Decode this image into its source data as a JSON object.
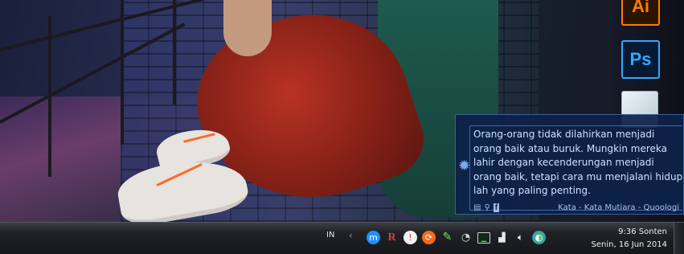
{
  "desktop": {
    "dock_icons": [
      {
        "label": "Ai",
        "icon": "illustrator-icon"
      },
      {
        "label": "Ps",
        "icon": "photoshop-icon"
      },
      {
        "label": "",
        "icon": "app-cube-icon"
      }
    ]
  },
  "notification": {
    "quote": "Orang-orang tidak dilahirkan menjadi orang baik atau buruk. Mungkin mereka lahir dengan kecenderungan menjadi orang baik, tetapi cara mu menjalani hidup lah yang paling penting.",
    "source": "Kata - Kata Mutiara - Quoologi",
    "icons": [
      "document-icon",
      "search-icon",
      "facebook-icon"
    ]
  },
  "taskbar": {
    "language": "IN",
    "overflow_chevron": "‹",
    "tray_icons": [
      "app-m-icon",
      "app-r-icon",
      "chat-icon",
      "update-icon",
      "pencil-icon",
      "sync-icon",
      "monitor-icon",
      "network-icon",
      "volume-icon",
      "globe-icon"
    ],
    "clock": {
      "time": "9:36 Sonten",
      "date": "Senin, 16 Jun 2014"
    }
  },
  "colors": {
    "notification_bg": "#0d2149",
    "notification_text": "#cfe0ff",
    "taskbar_bg": "#202327"
  }
}
